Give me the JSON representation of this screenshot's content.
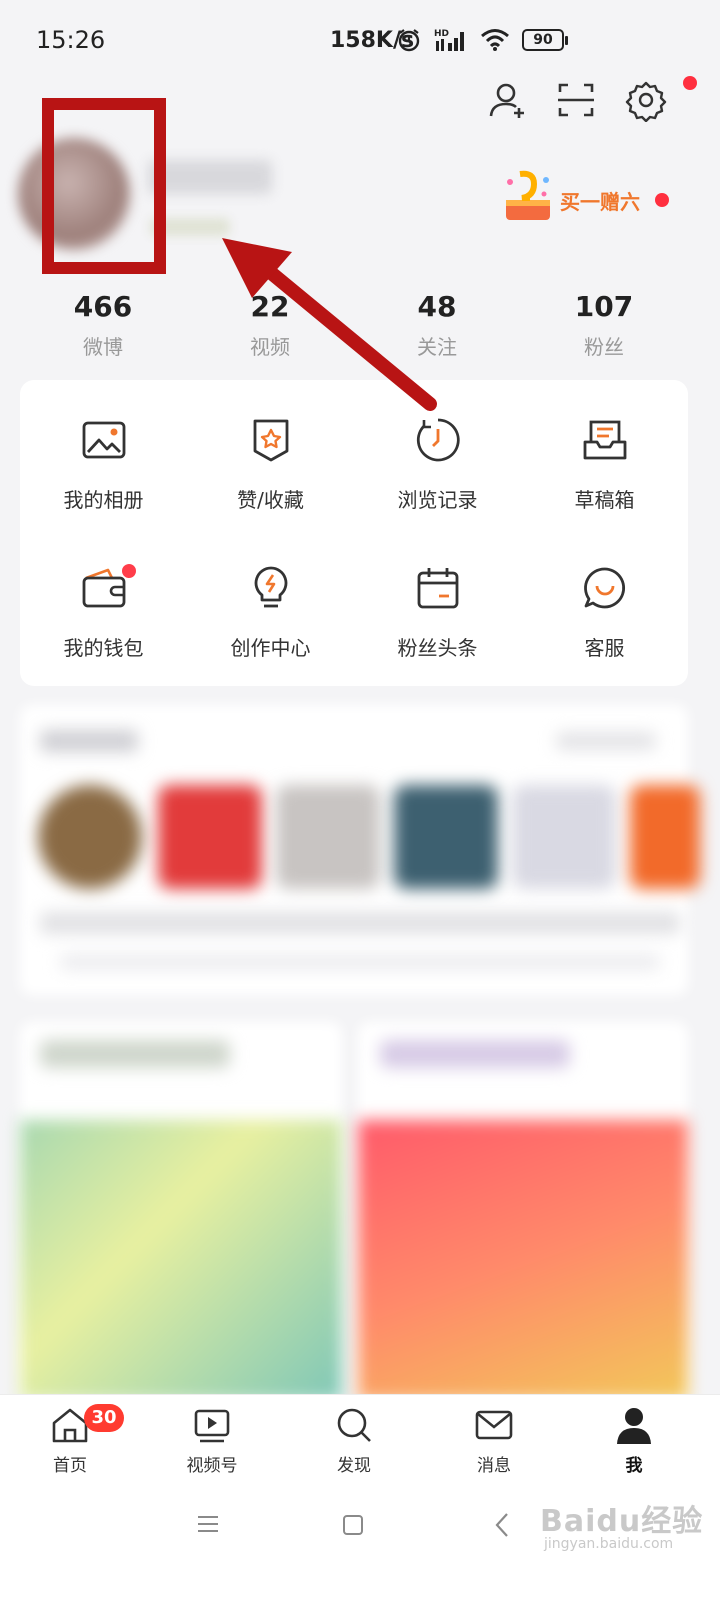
{
  "status_bar": {
    "time": "15:26",
    "speed": "158K/s",
    "battery": "90"
  },
  "promo": {
    "text": "买一赠六"
  },
  "stats": [
    {
      "value": "466",
      "label": "微博"
    },
    {
      "value": "22",
      "label": "视频"
    },
    {
      "value": "48",
      "label": "关注"
    },
    {
      "value": "107",
      "label": "粉丝"
    }
  ],
  "grid": [
    {
      "label": "我的相册",
      "icon": "photo-album-icon"
    },
    {
      "label": "赞/收藏",
      "icon": "favorites-icon"
    },
    {
      "label": "浏览记录",
      "icon": "history-clock-icon"
    },
    {
      "label": "草稿箱",
      "icon": "drafts-box-icon"
    },
    {
      "label": "我的钱包",
      "icon": "wallet-icon"
    },
    {
      "label": "创作中心",
      "icon": "lightbulb-icon"
    },
    {
      "label": "粉丝头条",
      "icon": "calendar-icon"
    },
    {
      "label": "客服",
      "icon": "customer-service-icon"
    }
  ],
  "bottom_nav": [
    {
      "label": "首页",
      "icon": "home-icon"
    },
    {
      "label": "视频号",
      "icon": "video-icon"
    },
    {
      "label": "发现",
      "icon": "search-icon"
    },
    {
      "label": "消息",
      "icon": "mail-icon"
    },
    {
      "label": "我",
      "icon": "person-icon"
    }
  ],
  "home_badge": "30",
  "watermark": {
    "brand": "Baidu经验",
    "url": "jingyan.baidu.com"
  },
  "colors": {
    "accent_orange": "#f0772d",
    "badge_red": "#ff3b30",
    "annotation_red": "#b81414"
  }
}
